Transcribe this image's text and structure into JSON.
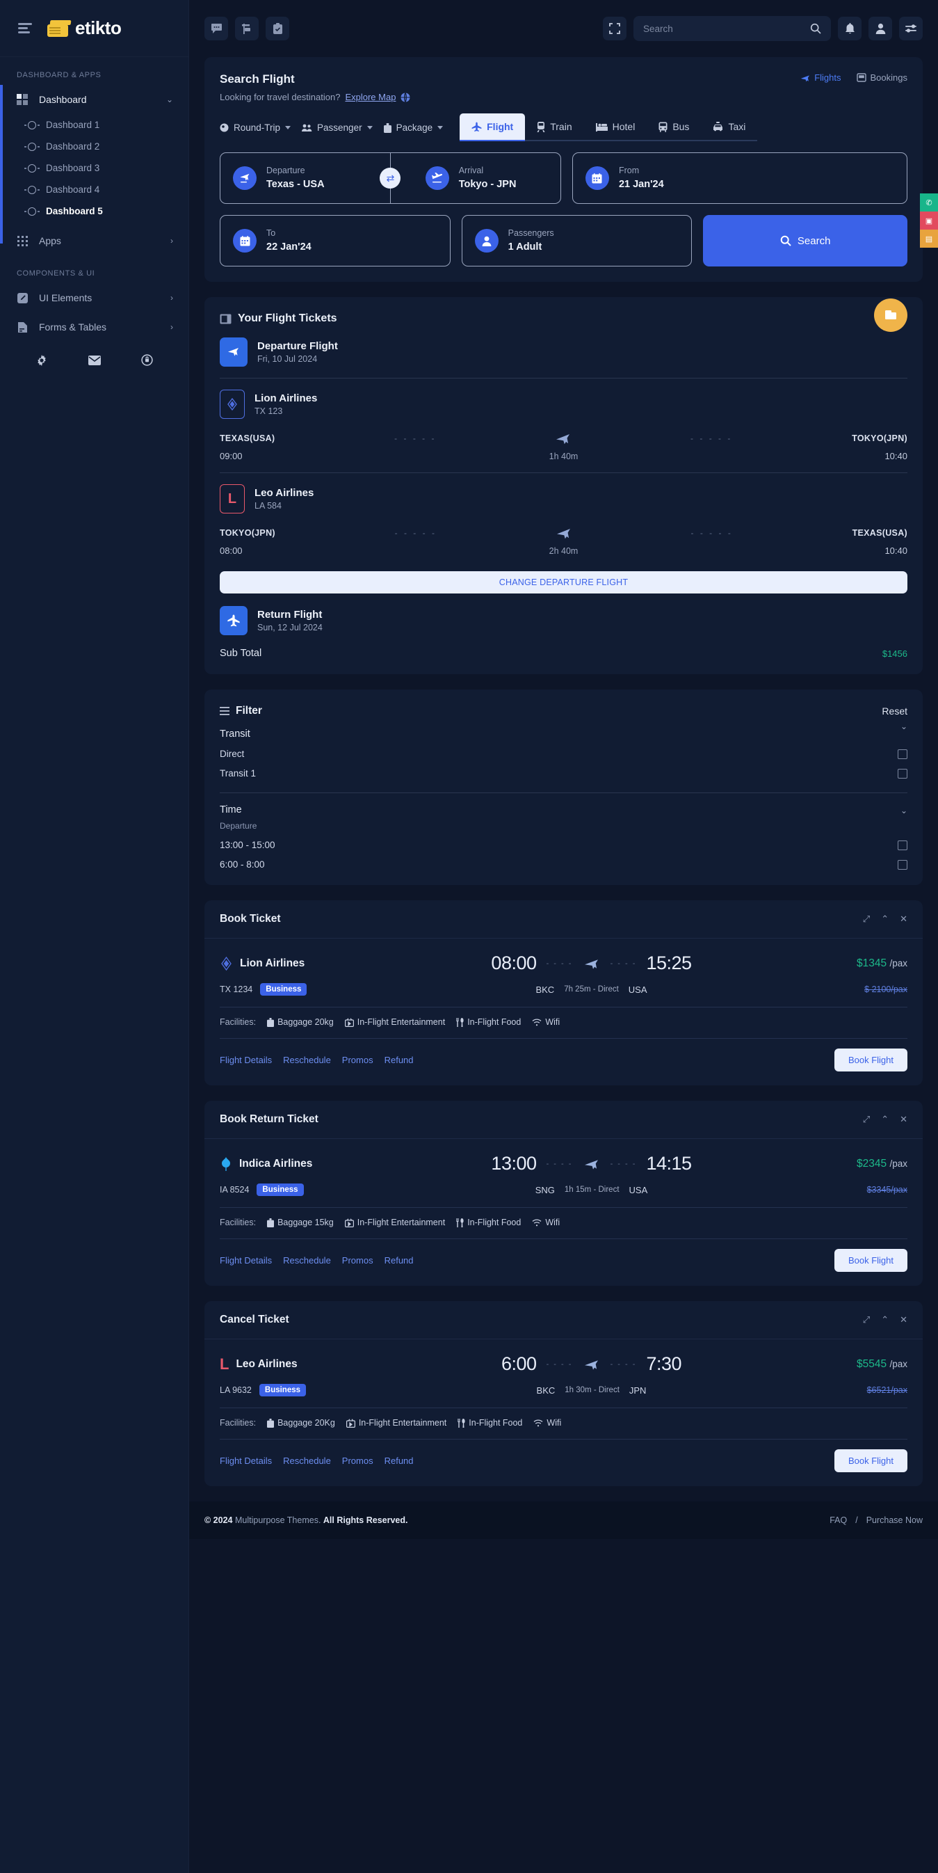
{
  "brand": {
    "name": "etikto",
    "logo_icon": "ticket-icon",
    "menu_icon": "hamburger-icon"
  },
  "sidebar": {
    "sections": [
      {
        "label": "Dashboard & Apps"
      },
      {
        "label": "Components & UI"
      }
    ],
    "dashboard": {
      "label": "Dashboard",
      "icon": "grid-icon",
      "chevron": "chevron-down-icon"
    },
    "dashboard_children": [
      {
        "label": "Dashboard 1"
      },
      {
        "label": "Dashboard 2"
      },
      {
        "label": "Dashboard 3"
      },
      {
        "label": "Dashboard 4"
      },
      {
        "label": "Dashboard 5"
      }
    ],
    "apps": {
      "label": "Apps",
      "icon": "apps-grid-icon",
      "chevron": "chevron-right-icon"
    },
    "components": [
      {
        "label": "UI Elements",
        "icon": "pencil-square-icon",
        "chevron": "chevron-right-icon"
      },
      {
        "label": "Forms & Tables",
        "icon": "document-icon",
        "chevron": "chevron-right-icon"
      }
    ],
    "bottom_icons": [
      "gear-icon",
      "envelope-icon",
      "lock-clock-icon"
    ]
  },
  "topbar": {
    "left_icons": [
      "chat-icon",
      "signpost-icon",
      "clipboard-check-icon"
    ],
    "fullscreen_icon": "fullscreen-icon",
    "search": {
      "placeholder": "Search",
      "value": "",
      "icon": "search-icon"
    },
    "right_icons": [
      "bell-icon",
      "user-icon",
      "settings-sliders-icon"
    ]
  },
  "search_flight": {
    "title": "Search Flight",
    "subtitle_text": "Looking for travel destination?",
    "subtitle_link": "Explore Map",
    "globe_icon": "globe-icon",
    "right_tabs": [
      {
        "label": "Flights",
        "icon": "plane-icon",
        "active": true
      },
      {
        "label": "Bookings",
        "icon": "booking-icon",
        "active": false
      }
    ],
    "dropdowns": [
      {
        "label": "Round-Trip",
        "icon": "globe-small-icon"
      },
      {
        "label": "Passenger",
        "icon": "people-icon"
      },
      {
        "label": "Package",
        "icon": "suitcase-icon"
      }
    ],
    "modes": [
      {
        "label": "Flight",
        "icon": "plane-icon",
        "active": true
      },
      {
        "label": "Train",
        "icon": "train-icon",
        "active": false
      },
      {
        "label": "Hotel",
        "icon": "bed-icon",
        "active": false
      },
      {
        "label": "Bus",
        "icon": "bus-icon",
        "active": false
      },
      {
        "label": "Taxi",
        "icon": "taxi-icon",
        "active": false
      }
    ],
    "fields": {
      "departure": {
        "label": "Departure",
        "value": "Texas - USA",
        "icon": "plane-depart-icon"
      },
      "arrival": {
        "label": "Arrival",
        "value": "Tokyo - JPN",
        "icon": "plane-arrive-icon"
      },
      "from": {
        "label": "From",
        "value": "21 Jan'24",
        "icon": "calendar-icon"
      },
      "to": {
        "label": "To",
        "value": "22 Jan'24",
        "icon": "calendar-icon"
      },
      "passengers": {
        "label": "Passengers",
        "value": "1 Adult",
        "icon": "user-icon"
      }
    },
    "swap_icon": "swap-icon",
    "search_button": {
      "label": "Search",
      "icon": "search-icon"
    }
  },
  "tickets_panel": {
    "title": "Your Flight Tickets",
    "title_icon": "ticket-panel-icon",
    "fab_icon": "ticket-fab-icon",
    "legs": [
      {
        "name": "Departure Flight",
        "date": "Fri, 10 Jul 2024",
        "icon": "plane-depart-icon"
      }
    ],
    "flights": [
      {
        "airline": "Lion Airlines",
        "code": "TX 123",
        "logo": "diamond-logo-icon",
        "from_city": "TEXAS(USA)",
        "to_city": "TOKYO(JPN)",
        "depart_time": "09:00",
        "arrive_time": "10:40",
        "duration": "1h 40m"
      },
      {
        "airline": "Leo Airlines",
        "code": "LA 584",
        "logo": "letter-l-logo-icon",
        "from_city": "TOKYO(JPN)",
        "to_city": "TEXAS(USA)",
        "depart_time": "08:00",
        "arrive_time": "10:40",
        "duration": "2h 40m"
      }
    ],
    "change_button": "CHANGE DEPARTURE FLIGHT",
    "return_leg": {
      "name": "Return Flight",
      "date": "Sun, 12 Jul 2024",
      "icon": "plane-arrive-icon"
    },
    "subtotal_label": "Sub Total",
    "subtotal_value": "$1456"
  },
  "filter": {
    "title": "Filter",
    "title_icon": "filter-lines-icon",
    "reset": "Reset",
    "groups": [
      {
        "title": "Transit",
        "note": null,
        "options": [
          {
            "label": "Direct",
            "checked": false
          },
          {
            "label": "Transit 1",
            "checked": false
          }
        ]
      },
      {
        "title": "Time",
        "note": "Departure",
        "options": [
          {
            "label": "13:00 - 15:00",
            "checked": false
          },
          {
            "label": "6:00 - 8:00",
            "checked": false
          }
        ]
      }
    ]
  },
  "ticket_cards": [
    {
      "title": "Book Ticket",
      "actions": [
        "expand-icon",
        "collapse-icon",
        "close-icon"
      ],
      "airline": "Lion Airlines",
      "logo": "diamond-logo-icon",
      "depart_time": "08:00",
      "arrive_time": "15:25",
      "price": "$1345",
      "price_unit": "/pax",
      "flight_code": "TX 1234",
      "class": "Business",
      "from_code": "BKC",
      "duration": "7h 25m - Direct",
      "to_code": "USA",
      "old_price": "$ 2100/pax",
      "facilities_label": "Facilities:",
      "facilities": [
        {
          "label": "Baggage 20kg",
          "icon": "baggage-icon"
        },
        {
          "label": "In-Flight Entertainment",
          "icon": "tv-icon"
        },
        {
          "label": "In-Flight Food",
          "icon": "cutlery-icon"
        },
        {
          "label": "Wifi",
          "icon": "wifi-icon"
        }
      ],
      "links": [
        "Flight Details",
        "Reschedule",
        "Promos",
        "Refund"
      ],
      "book_button": "Book Flight"
    },
    {
      "title": "Book Return Ticket",
      "actions": [
        "expand-icon",
        "collapse-icon",
        "close-icon"
      ],
      "airline": "Indica Airlines",
      "logo": "leaf-logo-icon",
      "depart_time": "13:00",
      "arrive_time": "14:15",
      "price": "$2345",
      "price_unit": "/pax",
      "flight_code": "IA 8524",
      "class": "Business",
      "from_code": "SNG",
      "duration": "1h 15m - Direct",
      "to_code": "USA",
      "old_price": "$3345/pax",
      "facilities_label": "Facilities:",
      "facilities": [
        {
          "label": "Baggage 15kg",
          "icon": "baggage-icon"
        },
        {
          "label": "In-Flight Entertainment",
          "icon": "tv-icon"
        },
        {
          "label": "In-Flight Food",
          "icon": "cutlery-icon"
        },
        {
          "label": "Wifi",
          "icon": "wifi-icon"
        }
      ],
      "links": [
        "Flight Details",
        "Reschedule",
        "Promos",
        "Refund"
      ],
      "book_button": "Book Flight"
    },
    {
      "title": "Cancel Ticket",
      "actions": [
        "expand-icon",
        "collapse-icon",
        "close-icon"
      ],
      "airline": "Leo Airlines",
      "logo": "letter-l-logo-icon",
      "depart_time": "6:00",
      "arrive_time": "7:30",
      "price": "$5545",
      "price_unit": "/pax",
      "flight_code": "LA 9632",
      "class": "Business",
      "from_code": "BKC",
      "duration": "1h 30m - Direct",
      "to_code": "JPN",
      "old_price": "$6521/pax",
      "facilities_label": "Facilities:",
      "facilities": [
        {
          "label": "Baggage 20Kg",
          "icon": "baggage-icon"
        },
        {
          "label": "In-Flight Entertainment",
          "icon": "tv-icon"
        },
        {
          "label": "In-Flight Food",
          "icon": "cutlery-icon"
        },
        {
          "label": "Wifi",
          "icon": "wifi-icon"
        }
      ],
      "links": [
        "Flight Details",
        "Reschedule",
        "Promos",
        "Refund"
      ],
      "book_button": "Book Flight"
    }
  ],
  "footer": {
    "copyright_year": "© 2024",
    "copyright_brand": "Multipurpose Themes.",
    "copyright_rest": "All Rights Reserved.",
    "links": [
      "FAQ",
      "/",
      "Purchase Now"
    ]
  },
  "colors": {
    "accent": "#3b62e8",
    "success": "#1db98a",
    "warning": "#f0b44a",
    "danger": "#e8596b",
    "panel": "#111c33",
    "bg": "#0d1528"
  }
}
